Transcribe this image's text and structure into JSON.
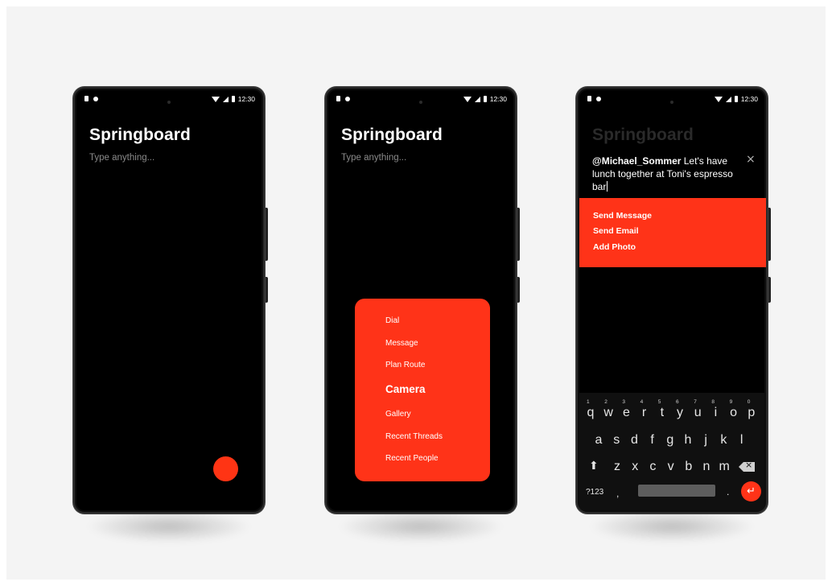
{
  "colors": {
    "accent": "#ff3318",
    "screen": "#000000",
    "background": "#f4f4f4"
  },
  "status_bar": {
    "time": "12:30"
  },
  "screen1": {
    "title": "Springboard",
    "placeholder": "Type anything..."
  },
  "screen2": {
    "title": "Springboard",
    "placeholder": "Type anything...",
    "menu": [
      "Dial",
      "Message",
      "Plan Route",
      "Camera",
      "Gallery",
      "Recent Threads",
      "Recent People"
    ],
    "highlighted": "Camera"
  },
  "screen3": {
    "title": "Springboard",
    "mention": "@Michael_Sommer",
    "message": " Let's have lunch together at Toni's espresso bar",
    "close_label": "×",
    "actions": [
      "Send Message",
      "Send Email",
      "Add Photo"
    ],
    "keyboard": {
      "row1": [
        "q",
        "w",
        "e",
        "r",
        "t",
        "y",
        "u",
        "i",
        "o",
        "p"
      ],
      "row1_numbers": [
        "1",
        "2",
        "3",
        "4",
        "5",
        "6",
        "7",
        "8",
        "9",
        "0"
      ],
      "row2": [
        "a",
        "s",
        "d",
        "f",
        "g",
        "h",
        "j",
        "k",
        "l"
      ],
      "row3": [
        "z",
        "x",
        "c",
        "v",
        "b",
        "n",
        "m"
      ],
      "symbols_label": "?123",
      "comma_label": ",",
      "period_label": ".",
      "shift_label": "⬆",
      "enter_label": "↵"
    }
  }
}
